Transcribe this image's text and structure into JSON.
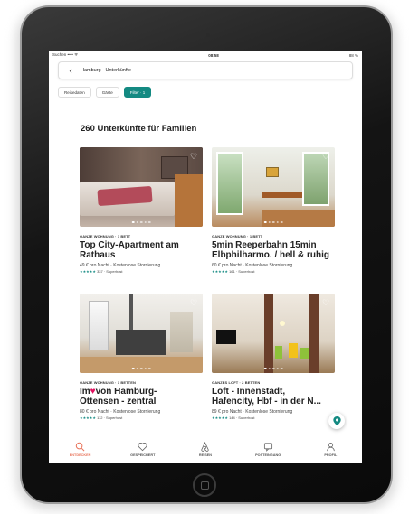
{
  "statusbar": {
    "left": "Suchen •••• ᯤ",
    "time": "08:58",
    "right": "88 %"
  },
  "urlbar": {
    "back_icon": "chevron-left-icon",
    "title": "Hamburg · Unterkünfte"
  },
  "filters": [
    {
      "label": "Reisedaten",
      "active": false
    },
    {
      "label": "Gäste",
      "active": false
    },
    {
      "label": "Filter · 1",
      "active": true
    }
  ],
  "heading": "260 Unterkünfte für Familien",
  "listings": [
    {
      "type": "GANZE WOHNUNG · 1 BETT",
      "title_line1": "Top City-Apartment am",
      "title_line2": "Rathaus",
      "price": "49 € pro Nacht · Kostenlose Stornierung",
      "stars": "★★★★★",
      "reviews": "337 · Superhost"
    },
    {
      "type": "GANZE WOHNUNG · 1 BETT",
      "title_line1": "5min Reeperbahn 15min",
      "title_line2": "Elbphilharmo. / hell & ruhig",
      "price": "60 € pro Nacht · Kostenlose Stornierung",
      "stars": "★★★★★",
      "reviews": "161 · Superhost"
    },
    {
      "type": "GANZE WOHNUNG · 3 BETTEN",
      "title_pre": "Im",
      "title_heart": "♥",
      "title_line1": "von Hamburg-",
      "title_line2": "Ottensen - zentral",
      "price": "80 € pro Nacht · Kostenlose Stornierung",
      "stars": "★★★★★",
      "reviews": "112 · Superhost"
    },
    {
      "type": "GANZES LOFT · 2 BETTEN",
      "title_line1": "Loft - Innenstadt,",
      "title_line2": "Hafencity, Hbf -  in der N...",
      "price": "89 € pro Nacht · Kostenlose Stornierung",
      "stars": "★★★★★",
      "reviews": "144 · Superhost"
    }
  ],
  "tabs": [
    {
      "label": "ENTDECKEN",
      "icon": "search-icon",
      "active": true
    },
    {
      "label": "GESPEICHERT",
      "icon": "heart-icon",
      "active": false
    },
    {
      "label": "REISEN",
      "icon": "airbnb-logo-icon",
      "active": false
    },
    {
      "label": "POSTEINGANG",
      "icon": "message-icon",
      "active": false
    },
    {
      "label": "PROFIL",
      "icon": "user-icon",
      "active": false
    }
  ],
  "colors": {
    "accent": "#148a82",
    "brand": "#e8735a",
    "heart": "#e0115f"
  }
}
